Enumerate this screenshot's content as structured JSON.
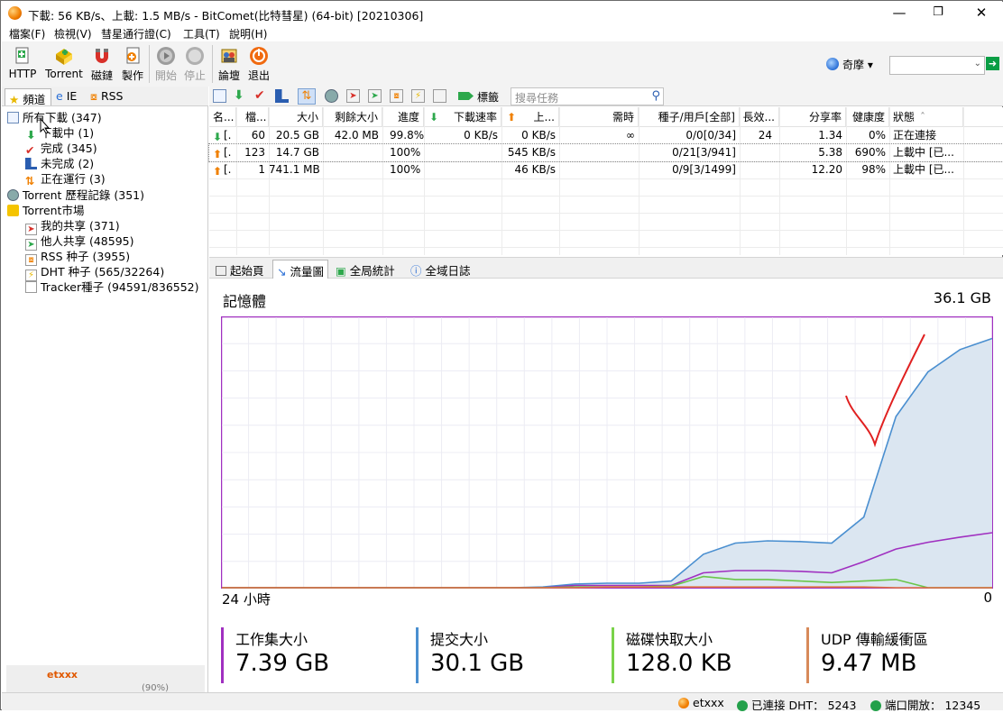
{
  "window": {
    "title": "下載: 56 KB/s、上載: 1.5 MB/s - BitComet(比特彗星) (64-bit) [20210306]",
    "minimize": "—",
    "maximize": "❐",
    "close": "✕"
  },
  "menu": [
    "檔案(F)",
    "檢視(V)",
    "彗星通行證(C)",
    "工具(T)",
    "說明(H)"
  ],
  "toolbar": {
    "http": "HTTP",
    "torrent": "Torrent",
    "magnet": "磁鏈",
    "make": "製作",
    "start": "開始",
    "stop": "停止",
    "forum": "論壇",
    "exit": "退出",
    "qimo": "奇摩 ▾",
    "go": "➜",
    "search_arrow": "⌵"
  },
  "left_tabs": [
    "頻道",
    "IE",
    "RSS"
  ],
  "tree": [
    {
      "label": "所有下載 (347)",
      "icon": "folder"
    },
    {
      "label": "下載中 (1)",
      "icon": "down-arrow"
    },
    {
      "label": "完成 (345)",
      "icon": "check"
    },
    {
      "label": "未完成 (2)",
      "icon": "incomplete"
    },
    {
      "label": "正在運行 (3)",
      "icon": "running"
    },
    {
      "label": "Torrent 歷程記錄 (351)",
      "icon": "history"
    },
    {
      "label": "Torrent市場",
      "icon": "market-folder"
    },
    {
      "label": "我的共享 (371)",
      "icon": "share"
    },
    {
      "label": "他人共享 (48595)",
      "icon": "others-share"
    },
    {
      "label": "RSS 种子 (3955)",
      "icon": "rss"
    },
    {
      "label": "DHT 种子 (565/32264)",
      "icon": "dht"
    },
    {
      "label": "Tracker種子 (94591/836552)",
      "icon": "tracker"
    }
  ],
  "ad": {
    "text": "etxxx",
    "pct": "(90%)"
  },
  "task_toolbar": {
    "tags_label": "標籤",
    "search_placeholder": "搜尋任務",
    "search_icon": "⚲"
  },
  "task_columns": [
    "名...",
    "檔...",
    "大小",
    "剩餘大小",
    "進度",
    "下載速率",
    "上...",
    "需時",
    "種子/用戶[全部]",
    "長效...",
    "分享率",
    "健康度",
    "狀態"
  ],
  "tasks": [
    {
      "icon": "down",
      "name": "[.",
      "files": "60",
      "size": "20.5 GB",
      "remaining": "42.0 MB",
      "progress": "99.8%",
      "down": "0 KB/s",
      "up": "0 KB/s",
      "eta": "∞",
      "peers": "0/0[0/34]",
      "longterm": "24",
      "ratio": "1.34",
      "health": "0%",
      "status": "正在連接"
    },
    {
      "icon": "up",
      "name": "[.",
      "files": "123",
      "size": "14.7 GB",
      "remaining": "",
      "progress": "100%",
      "down": "",
      "up": "545 KB/s",
      "eta": "",
      "peers": "0/21[3/941]",
      "longterm": "",
      "ratio": "5.38",
      "health": "690%",
      "status": "上載中 [已..."
    },
    {
      "icon": "up",
      "name": "[.",
      "files": "1",
      "size": "741.1 MB",
      "remaining": "",
      "progress": "100%",
      "down": "",
      "up": "46 KB/s",
      "eta": "",
      "peers": "0/9[3/1499]",
      "longterm": "",
      "ratio": "12.20",
      "health": "98%",
      "status": "上載中 [已..."
    }
  ],
  "detail_tabs": [
    "起始頁",
    "流量圖",
    "全局統計",
    "全域日誌"
  ],
  "chart_data": {
    "type": "area",
    "title": "記憶體",
    "max_label": "36.1 GB",
    "x_left_label": "24 小時",
    "x_right_label": "0",
    "ylim": [
      0,
      36.1
    ],
    "x_hours_ago": [
      24,
      23,
      22,
      21,
      20,
      19,
      18,
      17,
      16,
      15,
      14,
      13,
      12,
      11,
      10,
      9,
      8,
      7,
      6,
      5,
      4,
      3,
      2,
      1,
      0
    ],
    "series": [
      {
        "name": "提交大小",
        "color": "#4a8fd0",
        "values": [
          0,
          0,
          0,
          0,
          0,
          0,
          0,
          0,
          0,
          0,
          0.1,
          0.5,
          0.6,
          0.6,
          0.9,
          4.5,
          6.0,
          6.3,
          6.2,
          6.0,
          9.5,
          23.0,
          29.0,
          32.0,
          33.5
        ]
      },
      {
        "name": "工作集大小",
        "color": "#a030c0",
        "values": [
          0,
          0,
          0,
          0,
          0,
          0,
          0,
          0,
          0,
          0,
          0,
          0.3,
          0.3,
          0.3,
          0.3,
          2.0,
          2.3,
          2.3,
          2.2,
          2.0,
          3.5,
          5.2,
          6.1,
          6.8,
          7.39
        ]
      },
      {
        "name": "磁碟快取大小",
        "color": "#6ac64a",
        "values": [
          0,
          0,
          0,
          0,
          0,
          0,
          0,
          0,
          0,
          0,
          0,
          0.1,
          0.1,
          0.1,
          0.2,
          1.5,
          1.1,
          1.1,
          0.9,
          0.7,
          0.9,
          1.1,
          0,
          0,
          0
        ]
      },
      {
        "name": "UDP 傳輸緩衝區",
        "color": "#e07040",
        "values": [
          0,
          0,
          0,
          0,
          0,
          0,
          0,
          0,
          0,
          0,
          0,
          0,
          0.1,
          0.1,
          0.1,
          0.1,
          0.1,
          0.1,
          0.1,
          0.1,
          0.1,
          0,
          0,
          0,
          0
        ]
      }
    ]
  },
  "stats": [
    {
      "label": "工作集大小",
      "value": "7.39 GB",
      "color": "#a030c0"
    },
    {
      "label": "提交大小",
      "value": "30.1 GB",
      "color": "#4a8fd0"
    },
    {
      "label": "磁碟快取大小",
      "value": "128.0 KB",
      "color": "#7ad34a"
    },
    {
      "label": "UDP 傳輸緩衝區",
      "value": "9.47 MB",
      "color": "#d88a5a"
    }
  ],
  "statusbar": {
    "user": "etxxx",
    "dht": "已連接 DHT： 5243",
    "port": "端口開放： 12345"
  }
}
